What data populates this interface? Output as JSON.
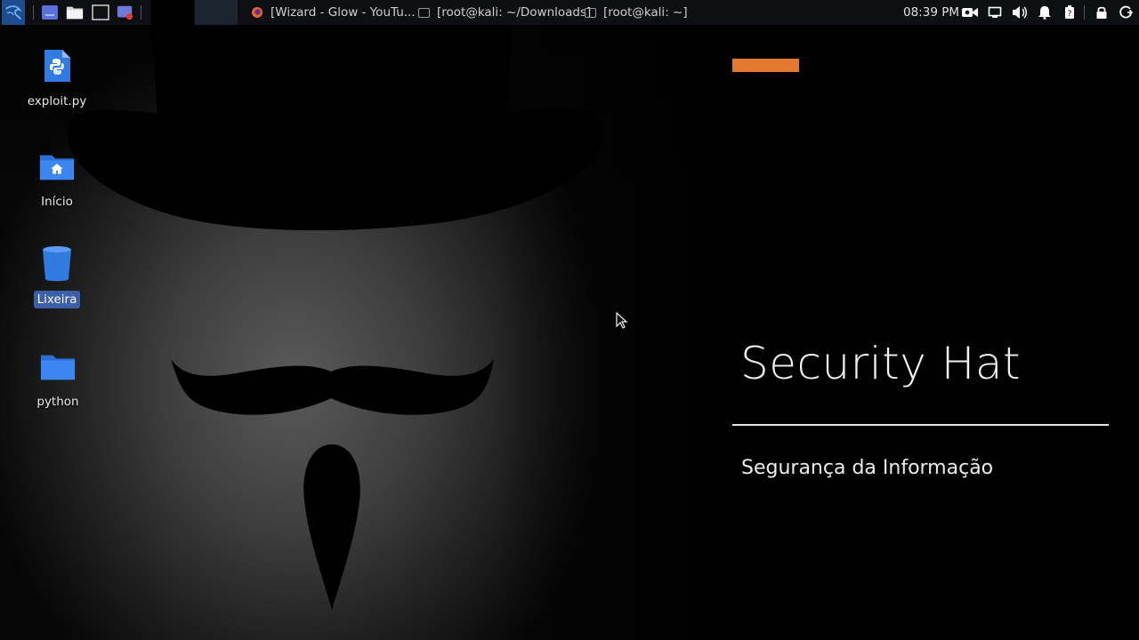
{
  "taskbar": {
    "windows": [
      {
        "icon": "firefox-icon",
        "title": "[Wizard - Glow - YouTu..."
      },
      {
        "icon": "terminal-window-icon",
        "title": "[root@kali: ~/Downloads]"
      },
      {
        "icon": "terminal-window-icon",
        "title": "[root@kali: ~]"
      }
    ],
    "launchers": [
      "kali-menu-icon",
      "desktop-icon",
      "file-manager-icon",
      "terminal-icon",
      "screen-recorder-icon"
    ],
    "clock": "08:39 PM",
    "tray_icons": [
      "camera-icon",
      "display-icon",
      "volume-icon",
      "notifications-icon",
      "battery-icon",
      "lock-icon",
      "logout-icon"
    ]
  },
  "desktop": {
    "icons": [
      {
        "label": "exploit.py",
        "icon": "python-file-icon",
        "selected": false
      },
      {
        "label": "Início",
        "icon": "home-folder-icon",
        "selected": false
      },
      {
        "label": "Lixeira",
        "icon": "trash-icon",
        "selected": true
      },
      {
        "label": "python",
        "icon": "folder-icon",
        "selected": false
      }
    ]
  },
  "branding": {
    "title": "Security Hat",
    "subtitle": "Segurança da Informação",
    "accent_color": "#e47a32"
  }
}
